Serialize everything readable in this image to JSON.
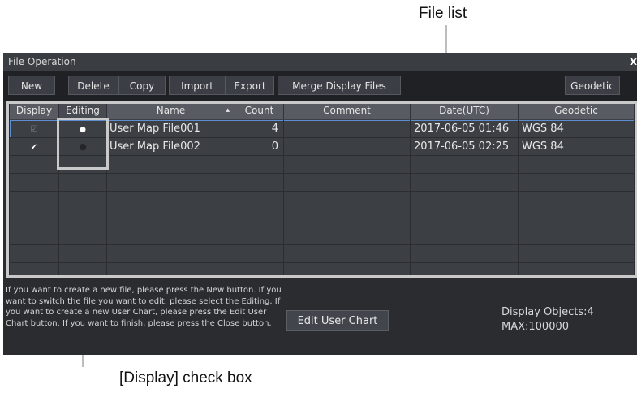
{
  "callouts": {
    "file_list": "File list",
    "display_checkbox": "[Display] check box"
  },
  "window": {
    "title": "File Operation",
    "close_glyph": "x"
  },
  "toolbar": {
    "new": "New",
    "delete": "Delete",
    "copy": "Copy",
    "import": "Import",
    "export": "Export",
    "merge": "Merge Display Files",
    "geodetic": "Geodetic"
  },
  "table": {
    "columns": [
      "Display",
      "Editing",
      "Name",
      "Count",
      "Comment",
      "Date(UTC)",
      "Geodetic"
    ],
    "sort_glyph": "▴",
    "rows": [
      {
        "display": "☑",
        "editing": "●",
        "name": "User Map File001",
        "count": "4",
        "comment": "",
        "date": "2017-06-05 01:46",
        "geodetic": "WGS 84"
      },
      {
        "display": "✔",
        "editing": "●",
        "name": "User Map File002",
        "count": "0",
        "comment": "",
        "date": "2017-06-05 02:25",
        "geodetic": "WGS 84"
      }
    ]
  },
  "footer": {
    "help_text": "If you want to create a new file, please press the New button. If you want to switch the file you want to edit, please select the Editing. If you want to create a new User Chart, please press the Edit User Chart button. If you want to finish, please press the Close button.",
    "edit_user_chart": "Edit User Chart",
    "display_objects": "Display Objects:4",
    "max": "MAX:100000"
  },
  "colors": {
    "selection": "#5d8fd0",
    "callout_frame": "#c9c9c9"
  }
}
